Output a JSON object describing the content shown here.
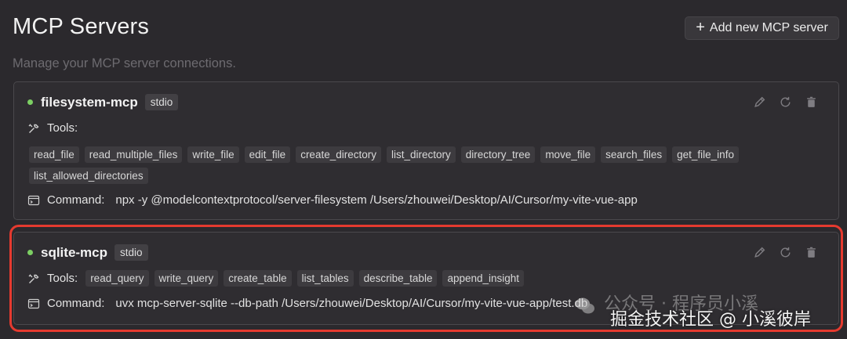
{
  "header": {
    "title": "MCP Servers",
    "subtitle": "Manage your MCP server connections.",
    "add_button_label": "Add new MCP server"
  },
  "servers": [
    {
      "name": "filesystem-mcp",
      "transport": "stdio",
      "status_color": "#7ccf63",
      "tools_label": "Tools:",
      "tools": [
        "read_file",
        "read_multiple_files",
        "write_file",
        "edit_file",
        "create_directory",
        "list_directory",
        "directory_tree",
        "move_file",
        "search_files",
        "get_file_info",
        "list_allowed_directories"
      ],
      "command_label": "Command:",
      "command": "npx -y @modelcontextprotocol/server-filesystem /Users/zhouwei/Desktop/AI/Cursor/my-vite-vue-app"
    },
    {
      "name": "sqlite-mcp",
      "transport": "stdio",
      "status_color": "#7ccf63",
      "tools_label": "Tools:",
      "tools": [
        "read_query",
        "write_query",
        "create_table",
        "list_tables",
        "describe_table",
        "append_insight"
      ],
      "command_label": "Command:",
      "command": "uvx mcp-server-sqlite --db-path /Users/zhouwei/Desktop/AI/Cursor/my-vite-vue-app/test.db"
    }
  ],
  "watermark": {
    "line1": "公众号 · 程序员小溪",
    "line2": "掘金技术社区 @ 小溪彼岸"
  },
  "colors": {
    "highlight_frame": "#e53a2f",
    "background": "#2b292d"
  }
}
